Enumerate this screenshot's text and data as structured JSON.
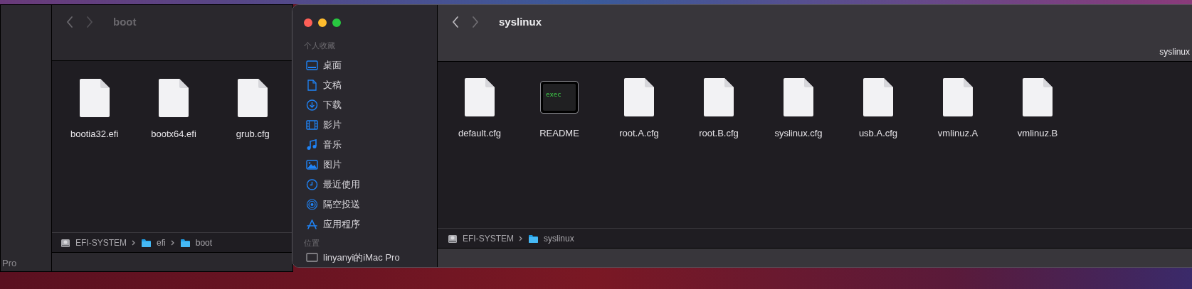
{
  "back_window": {
    "title": "boot",
    "sidebar_text": "Pro",
    "files": [
      {
        "name": "bootia32.efi",
        "kind": "document"
      },
      {
        "name": "bootx64.efi",
        "kind": "document"
      },
      {
        "name": "grub.cfg",
        "kind": "document"
      }
    ],
    "path": [
      {
        "label": "EFI-SYSTEM",
        "kind": "disk"
      },
      {
        "label": "efi",
        "kind": "folder"
      },
      {
        "label": "boot",
        "kind": "folder"
      }
    ]
  },
  "front_window": {
    "title": "syslinux",
    "tab_label": "syslinux",
    "sidebar": [
      {
        "heading": "个人收藏",
        "items": [
          {
            "label": "桌面",
            "kind": "desktop"
          },
          {
            "label": "文稿",
            "kind": "document"
          },
          {
            "label": "下载",
            "kind": "download"
          },
          {
            "label": "影片",
            "kind": "movies"
          },
          {
            "label": "音乐",
            "kind": "music"
          },
          {
            "label": "图片",
            "kind": "pictures"
          },
          {
            "label": "最近使用",
            "kind": "recents"
          },
          {
            "label": "隔空投送",
            "kind": "airdrop"
          },
          {
            "label": "应用程序",
            "kind": "applications"
          }
        ]
      },
      {
        "heading": "位置",
        "items": [
          {
            "label": "linyanyi的iMac Pro",
            "kind": "computer"
          }
        ]
      }
    ],
    "files": [
      {
        "name": "default.cfg",
        "kind": "document"
      },
      {
        "name": "README",
        "kind": "executable",
        "icon_text": "exec"
      },
      {
        "name": "root.A.cfg",
        "kind": "document"
      },
      {
        "name": "root.B.cfg",
        "kind": "document"
      },
      {
        "name": "syslinux.cfg",
        "kind": "document"
      },
      {
        "name": "usb.A.cfg",
        "kind": "document"
      },
      {
        "name": "vmlinuz.A",
        "kind": "document"
      },
      {
        "name": "vmlinuz.B",
        "kind": "document"
      }
    ],
    "path": [
      {
        "label": "EFI-SYSTEM",
        "kind": "disk"
      },
      {
        "label": "syslinux",
        "kind": "folder"
      }
    ]
  }
}
